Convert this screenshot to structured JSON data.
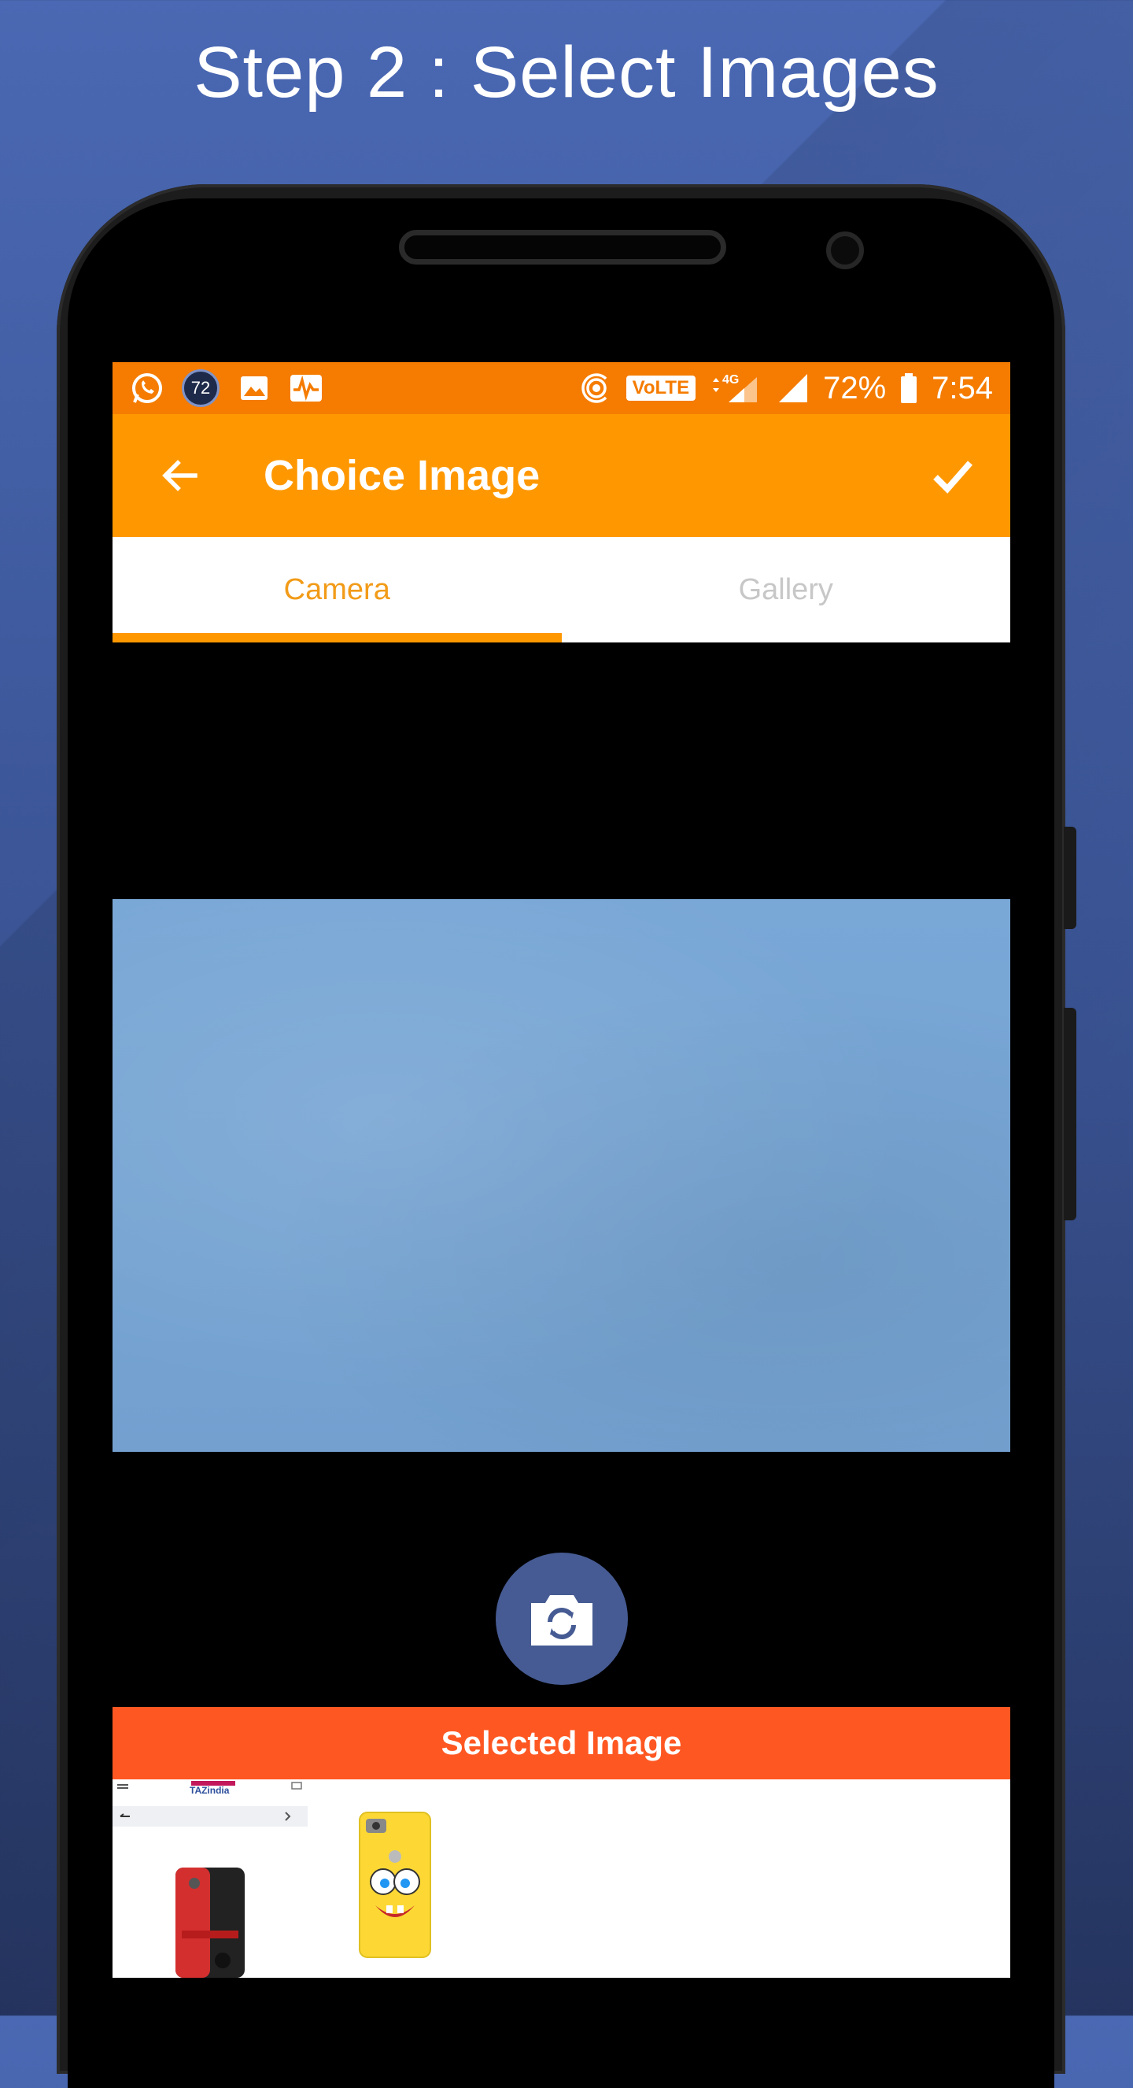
{
  "headline": "Step 2 : Select Images",
  "status_bar": {
    "notification_badge": "72",
    "network": "4G",
    "volte": "VoLTE",
    "battery": "72%",
    "time": "7:54"
  },
  "app_bar": {
    "title": "Choice Image"
  },
  "tabs": [
    {
      "label": "Camera",
      "active": true
    },
    {
      "label": "Gallery",
      "active": false
    }
  ],
  "selected_section": {
    "label": "Selected Image",
    "thumb_caption": "TAZindia"
  },
  "colors": {
    "status_bar": "#f57c00",
    "app_bar": "#ff9800",
    "selected_bar": "#ff5722",
    "shutter": "#465b93",
    "background": "#3b5596"
  }
}
